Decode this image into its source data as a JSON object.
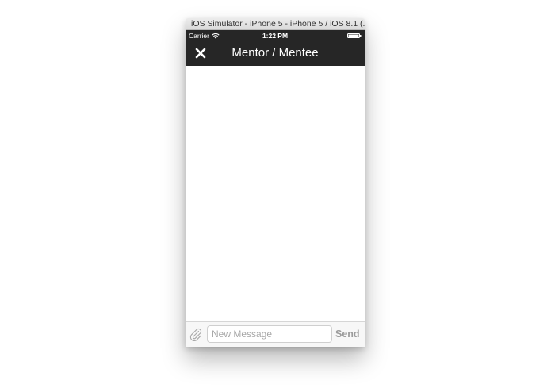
{
  "window": {
    "title": "iOS Simulator - iPhone 5 - iPhone 5 / iOS 8.1 (..."
  },
  "status_bar": {
    "carrier": "Carrier",
    "time": "1:22 PM",
    "battery_level": 1.0,
    "wifi_icon": "wifi-icon",
    "battery_icon": "battery-icon"
  },
  "nav": {
    "title": "Mentor / Mentee",
    "close_icon": "close-icon"
  },
  "composer": {
    "placeholder": "New Message",
    "value": "",
    "send_label": "Send",
    "attach_icon": "paperclip-icon"
  },
  "colors": {
    "navbar": "#262626",
    "send_disabled": "#9b9b9b"
  }
}
